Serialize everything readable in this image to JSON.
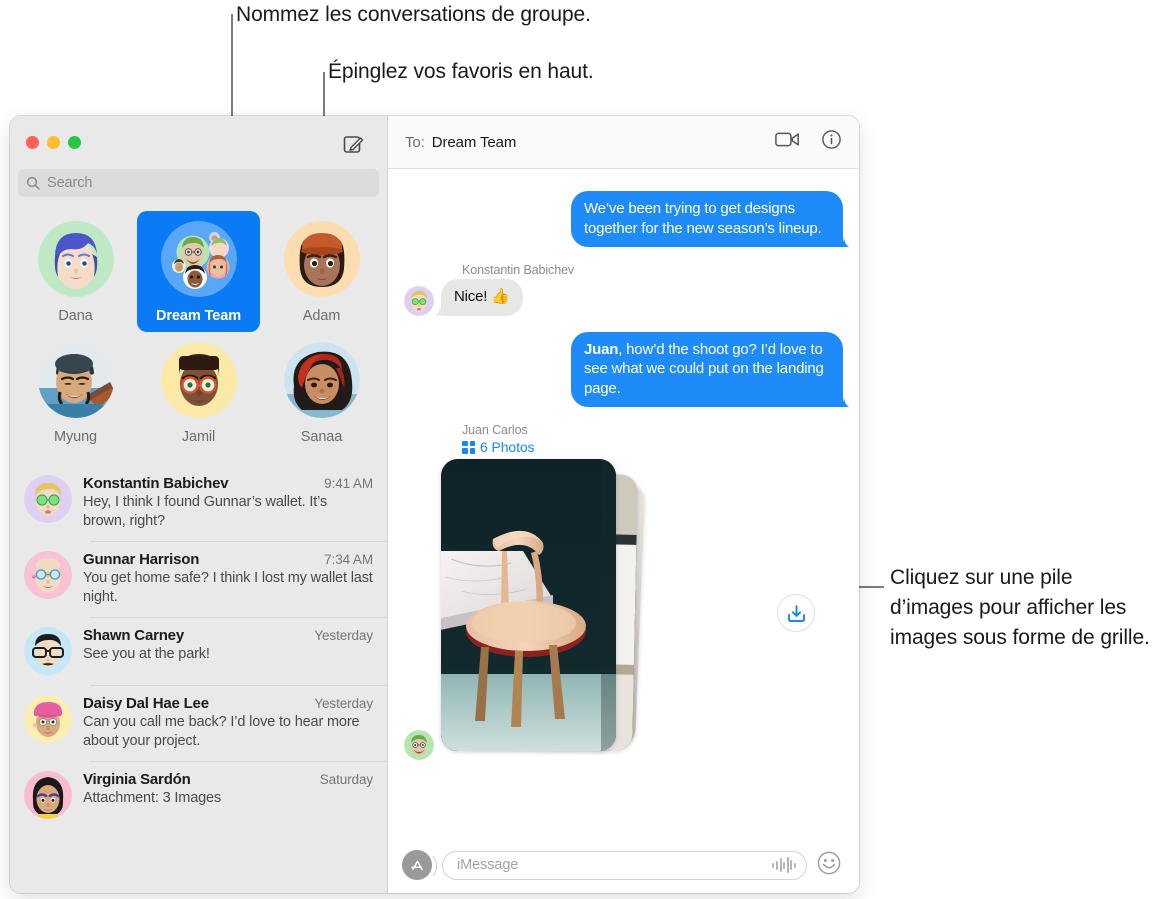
{
  "callouts": {
    "group_name": "Nommez les conversations de groupe.",
    "pin_favorites": "Épinglez vos favoris en haut.",
    "image_stack": "Cliquez sur une pile d’images pour afficher les images sous forme de grille."
  },
  "sidebar": {
    "window_controls": [
      "close",
      "minimize",
      "zoom"
    ],
    "compose_icon": "compose-icon",
    "search": {
      "placeholder": "Search",
      "icon": "search-icon"
    },
    "pinned": [
      {
        "label": "Dana",
        "selected": false,
        "type": "memoji"
      },
      {
        "label": "Dream Team",
        "selected": true,
        "type": "group"
      },
      {
        "label": "Adam",
        "selected": false,
        "type": "memoji"
      },
      {
        "label": "Myung",
        "selected": false,
        "type": "photo"
      },
      {
        "label": "Jamil",
        "selected": false,
        "type": "memoji"
      },
      {
        "label": "Sanaa",
        "selected": false,
        "type": "photo"
      }
    ],
    "conversations": [
      {
        "name": "Konstantin Babichev",
        "time": "9:41 AM",
        "preview": "Hey, I think I found Gunnar’s wallet. It’s brown, right?"
      },
      {
        "name": "Gunnar Harrison",
        "time": "7:34 AM",
        "preview": "You get home safe? I think I lost my wallet last night."
      },
      {
        "name": "Shawn Carney",
        "time": "Yesterday",
        "preview": "See you at the park!"
      },
      {
        "name": "Daisy Dal Hae Lee",
        "time": "Yesterday",
        "preview": "Can you call me back? I’d love to hear more about your project."
      },
      {
        "name": "Virginia Sardón",
        "time": "Saturday",
        "preview": "Attachment: 3 Images"
      }
    ]
  },
  "conversation": {
    "to_label": "To:",
    "to_value": "Dream Team",
    "facetime_icon": "video-camera-icon",
    "info_icon": "info-circle-icon",
    "messages": [
      {
        "direction": "out",
        "text": "We’ve been trying to get designs together for the new season’s lineup."
      },
      {
        "direction": "in",
        "sender": "Konstantin Babichev",
        "text": "Nice!  👍"
      },
      {
        "direction": "out",
        "mention": "Juan",
        "text": ", how’d the shoot go? I’d love to see what we could put on the landing page."
      }
    ],
    "photo_message": {
      "sender": "Juan Carlos",
      "count_label": "6 Photos",
      "grid_icon": "grid-icon",
      "download_icon": "download-icon"
    },
    "composer": {
      "apps_icon": "app-store-icon",
      "placeholder": "iMessage",
      "audio_icon": "audio-waveform-icon",
      "emoji_icon": "smiley-face-icon"
    }
  },
  "colors": {
    "accent_blue": "#1e8bf8",
    "pinned_selected": "#0b7bf5",
    "bubble_in": "#e7e7e8",
    "sidebar_bg": "#e9e9e9",
    "traffic_red": "#ff6059",
    "traffic_yellow": "#ffbd2e",
    "traffic_green": "#28c940"
  }
}
